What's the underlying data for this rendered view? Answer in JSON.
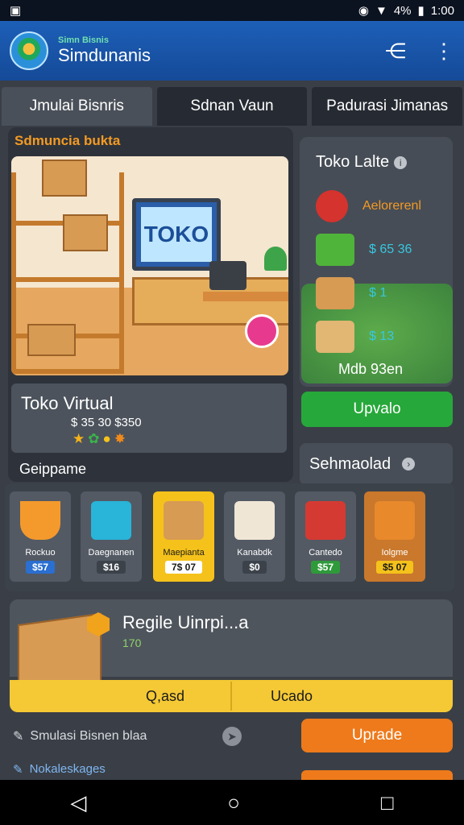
{
  "status": {
    "battery": "4%",
    "time": "1:00"
  },
  "app": {
    "subtitle": "Simn Bisnis",
    "title": "Simdunanis",
    "share_icon": "share-icon",
    "menu_icon": "more-vert-icon"
  },
  "tabs": [
    {
      "label": "Jmulai Bisnris",
      "active": true
    },
    {
      "label": "Sdnan Vaun",
      "active": false
    },
    {
      "label": "Padurasi Jimanas",
      "active": false
    }
  ],
  "main": {
    "section_title": "Sdmuncia bukta",
    "scene_sign": "TOKO",
    "store_name": "Toko Virtual",
    "store_value": "$ 35 30 $350",
    "category_label": "Geippame"
  },
  "side": {
    "title": "Toko Lalte",
    "items": [
      {
        "icon": "badge-icon",
        "value": "Aelorerenl"
      },
      {
        "icon": "cash-icon",
        "value": "$ 65 36"
      },
      {
        "icon": "boxes-icon",
        "value": "$ 1"
      },
      {
        "icon": "card-icon",
        "value": "$ 13"
      }
    ],
    "total": "Mdb 93en",
    "upgrade_button": "Upvalo",
    "schedule": "Sehmaolad"
  },
  "shelf": [
    {
      "name": "Rockuo",
      "price": "$57",
      "icon": "bucket-icon"
    },
    {
      "name": "Daegnanen",
      "price": "$16",
      "icon": "cube-icon"
    },
    {
      "name": "Maepianta",
      "price": "7$ 07",
      "icon": "package-icon"
    },
    {
      "name": "Kanabdk",
      "price": "$0",
      "icon": "pack-icon"
    },
    {
      "name": "Cantedo",
      "price": "$57",
      "icon": "redbox-icon"
    },
    {
      "name": "Iolgme",
      "price": "$5 07",
      "icon": "cart-icon"
    }
  ],
  "promo": {
    "title": "Regile Uinrpi...a",
    "sub": "170",
    "btn_left": "Q,asd",
    "btn_right": "Ucado"
  },
  "bottom": {
    "simulasi": "Smulasi Bisnen blaa",
    "upgrade": "Uprade",
    "tracking": "Nokaleskages"
  }
}
